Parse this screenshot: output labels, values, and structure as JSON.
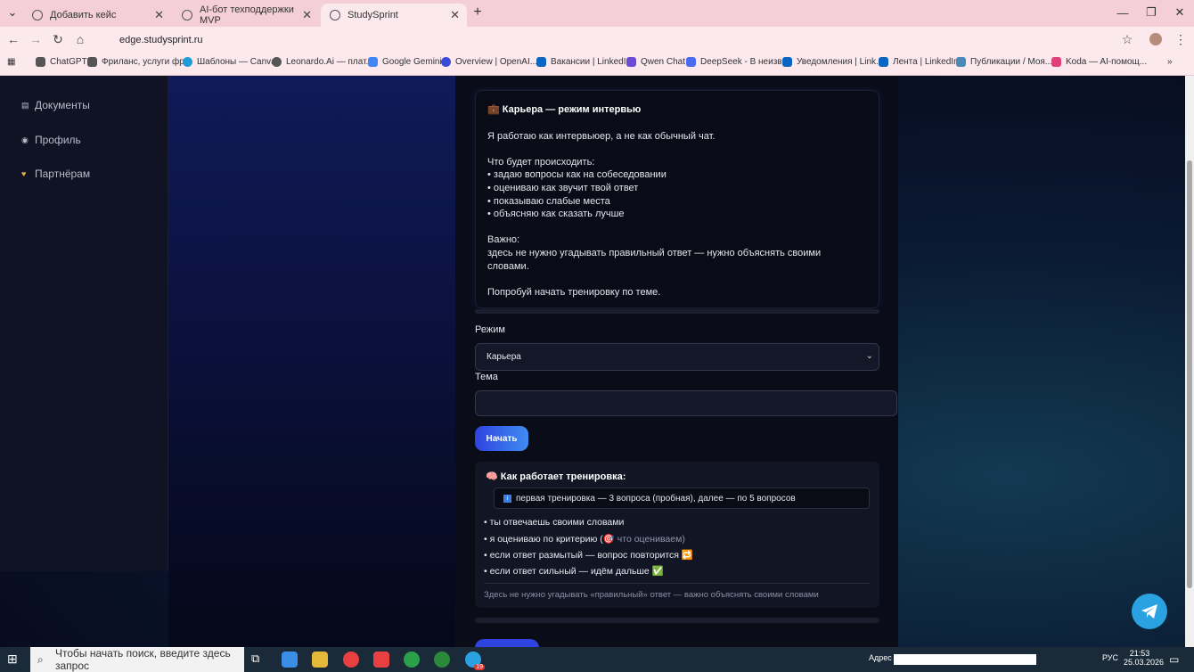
{
  "browser": {
    "tabs": [
      {
        "title": "Добавить кейс",
        "active": false
      },
      {
        "title": "AI-бот техподдержки MVP",
        "active": false
      },
      {
        "title": "StudySprint",
        "active": true
      }
    ],
    "url": "edge.studysprint.ru",
    "bookmarks": [
      "ChatGPT",
      "Фриланс, услуги фр...",
      "Шаблоны — Canva",
      "Leonardo.Ai — плат...",
      "Google Gemini",
      "Overview | OpenAI...",
      "Вакансии | LinkedIn",
      "Qwen Chat",
      "DeepSeek - В неизв...",
      "Уведомления | Link...",
      "Лента | LinkedIn",
      "Публикации / Моя...",
      "Koda — AI-помощ..."
    ]
  },
  "sidebar": {
    "items": [
      {
        "label": "Документы",
        "icon": "document-icon"
      },
      {
        "label": "Профиль",
        "icon": "user-icon"
      },
      {
        "label": "Партнёрам",
        "icon": "handshake-icon"
      }
    ]
  },
  "intro": {
    "title": "💼 Карьера — режим интервью",
    "lines": [
      "Я работаю как интервьюер, а не как обычный чат.",
      "Что будет происходить:",
      "• задаю вопросы как на собеседовании",
      "• оцениваю как звучит твой ответ",
      "• показываю слабые места",
      "• объясняю как сказать лучше",
      "Важно:",
      "здесь не нужно угадывать правильный ответ — нужно объяснять своими",
      "словами.",
      "Попробуй начать тренировку по теме."
    ]
  },
  "form": {
    "mode_label": "Режим",
    "mode_value": "Карьера",
    "topic_label": "Тема",
    "topic_value": "",
    "start_label": "Начать"
  },
  "training": {
    "title": "🧠 Как работает тренировка:",
    "pill": "первая тренировка — 3 вопроса (пробная), далее — по 5 вопросов",
    "items": [
      "• ты отвечаешь своими словами",
      "• я оцениваю по критерию (",
      "🎯 что оцениваем",
      ")",
      "• если ответ размытый — вопрос повторится 🔁",
      "• если ответ сильный — идём дальше ✅"
    ],
    "footer": "Здесь не нужно угадывать «правильный» ответ — важно объяснять своими словами"
  },
  "taskbar": {
    "search_placeholder": "Чтобы начать поиск, введите здесь запрос",
    "address_label": "Адрес",
    "lang": "РУС",
    "time": "21:53",
    "date": "25.03.2026",
    "badge": "19"
  }
}
